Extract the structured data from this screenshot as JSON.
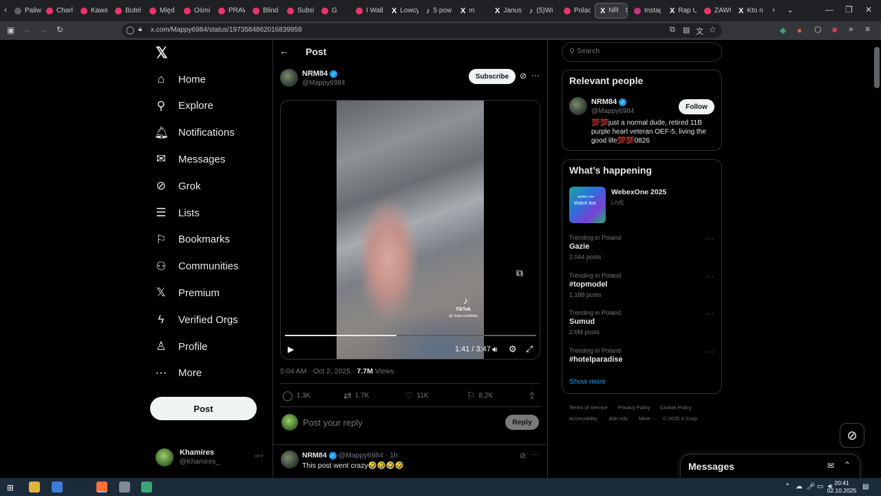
{
  "browser": {
    "tabs": [
      {
        "label": "Paliw",
        "fav": "#5f6368"
      },
      {
        "label": "Charl",
        "fav": "#e8366b"
      },
      {
        "label": "Kawal",
        "fav": "#e8366b"
      },
      {
        "label": "Butel",
        "fav": "#e8366b"
      },
      {
        "label": "Międ",
        "fav": "#e8366b"
      },
      {
        "label": "Ośmi",
        "fav": "#e8366b"
      },
      {
        "label": "PRAW",
        "fav": "#e8366b"
      },
      {
        "label": "Blind",
        "fav": "#e8366b"
      },
      {
        "label": "Subsk",
        "fav": "#e8366b"
      },
      {
        "label": "G",
        "fav": "#e8366b"
      },
      {
        "label": "I Walk",
        "fav": "#e8366b"
      },
      {
        "label": "Lowcy",
        "fav": "x"
      },
      {
        "label": "5 pow",
        "fav": "tiktok"
      },
      {
        "label": "m",
        "fav": "x"
      },
      {
        "label": "Janus",
        "fav": "x"
      },
      {
        "label": "(5)Wi",
        "fav": "tiktok"
      },
      {
        "label": "Polacy",
        "fav": "#e8366b"
      },
      {
        "label": "NR",
        "fav": "x"
      },
      {
        "label": "Instag",
        "fav": "#c13584"
      },
      {
        "label": "Rap U",
        "fav": "x"
      },
      {
        "label": "ZAWC",
        "fav": "#e8366b"
      },
      {
        "label": "Kto n",
        "fav": "x"
      }
    ],
    "url": "x.com/Mappy6984/status/1973584862016839958"
  },
  "nav": {
    "items": [
      {
        "label": "Home",
        "icon": "home-icon",
        "glyph": "⌂"
      },
      {
        "label": "Explore",
        "icon": "search-icon",
        "glyph": "⚲"
      },
      {
        "label": "Notifications",
        "icon": "bell-icon",
        "glyph": "🔔︎"
      },
      {
        "label": "Messages",
        "icon": "envelope-icon",
        "glyph": "✉"
      },
      {
        "label": "Grok",
        "icon": "grok-icon",
        "glyph": "⊘"
      },
      {
        "label": "Lists",
        "icon": "list-icon",
        "glyph": "☰"
      },
      {
        "label": "Bookmarks",
        "icon": "bookmark-icon",
        "glyph": "⚐"
      },
      {
        "label": "Communities",
        "icon": "communities-icon",
        "glyph": "⚇"
      },
      {
        "label": "Premium",
        "icon": "x-logo-icon",
        "glyph": "𝕏"
      },
      {
        "label": "Verified Orgs",
        "icon": "lightning-icon",
        "glyph": "ϟ"
      },
      {
        "label": "Profile",
        "icon": "user-icon",
        "glyph": "♙"
      },
      {
        "label": "More",
        "icon": "more-circle-icon",
        "glyph": "⋯"
      }
    ],
    "post_label": "Post",
    "account": {
      "name": "Khamires",
      "handle": "@Khamires_"
    }
  },
  "header": {
    "title": "Post"
  },
  "tweet": {
    "author": "NRM84",
    "handle": "@Mappy6984",
    "subscribe_label": "Subscribe",
    "video": {
      "elapsed": "1:41",
      "separator": "/",
      "duration": "3:47",
      "progress": 0.445,
      "watermark_brand": "TikTok",
      "watermark_handle": "@ hope.cambdia"
    },
    "timestamp": "5:04 AM · Oct 2, 2025 ·",
    "views_count": "7.7M",
    "views_label": "Views",
    "stats": {
      "replies": "1.3K",
      "reposts": "1.7K",
      "likes": "11K",
      "bookmarks": "8.2K"
    }
  },
  "reply": {
    "placeholder": "Post your reply",
    "button": "Reply"
  },
  "next_tweet": {
    "author": "NRM84",
    "handle": "@Mappy6984",
    "time": "· 1h",
    "text": "This post went crazy🤣🤣🤣🤣"
  },
  "sidebar": {
    "search_placeholder": "Search",
    "relevant": {
      "title": "Relevant people",
      "name": "NRM84",
      "handle": "@Mappy6984",
      "follow_label": "Follow",
      "bio": "💯💯just a normal dude, retired 11B purple heart veteran OEF-5, living the good life💯💯0826"
    },
    "happening": {
      "title": "What’s happening",
      "event": {
        "name": "WebexOne 2025",
        "status": "LIVE",
        "thumb_brand": "webex one",
        "thumb_cta": "Watch live"
      },
      "trends": [
        {
          "meta": "Trending in Poland",
          "title": "Gazie",
          "count": "2,044 posts"
        },
        {
          "meta": "Trending in Poland",
          "title": "#topmodel",
          "count": "1,188 posts"
        },
        {
          "meta": "Trending in Poland",
          "title": "Sumud",
          "count": "2.6M posts"
        },
        {
          "meta": "Trending in Poland",
          "title": "#hotelparadise",
          "count": ""
        }
      ],
      "show_more": "Show more"
    },
    "footer": [
      "Terms of Service",
      "Privacy Policy",
      "Cookie Policy",
      "Accessibility",
      "Ads info",
      "More ···",
      "© 2025 X Corp."
    ]
  },
  "messages_drawer": {
    "title": "Messages"
  },
  "taskbar": {
    "time": "20:41",
    "date": "02.10.2025"
  },
  "colors": {
    "accent": "#1d9bf0",
    "background": "#000000",
    "border": "#2f3336",
    "muted": "#71767b"
  }
}
